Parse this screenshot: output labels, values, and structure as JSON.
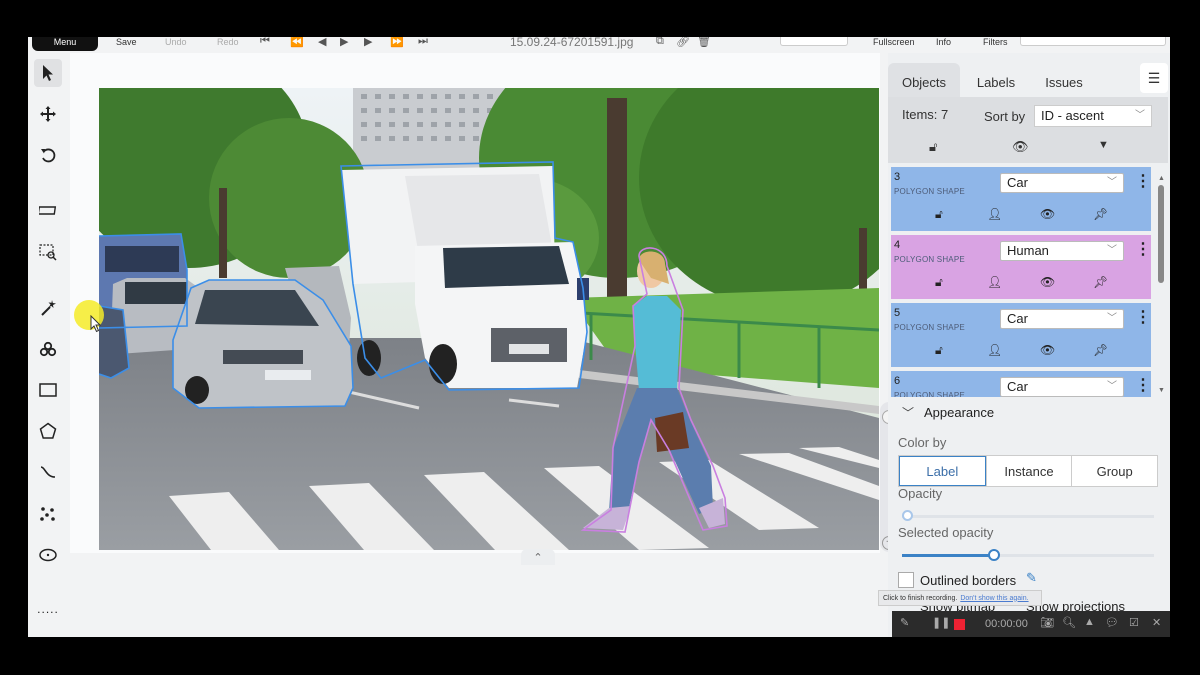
{
  "toolbar": {
    "menu": "Menu",
    "save": "Save",
    "undo": "Undo",
    "redo": "Redo",
    "filename": "15.09.24-67201591.jpg",
    "fullscreen": "Fullscreen",
    "info": "Info",
    "filters": "Filters"
  },
  "left_tools": [
    "cursor-icon",
    "move-icon",
    "rotate-icon",
    "ruler-icon",
    "zoom-region-icon",
    "magic-wand-icon",
    "brush-icon",
    "rectangle-icon",
    "polygon-icon",
    "polyline-icon",
    "points-icon",
    "ellipse-icon",
    "more-icon"
  ],
  "panel": {
    "tabs": [
      "Objects",
      "Labels",
      "Issues"
    ],
    "items_count": "Items: 7",
    "sort_by_label": "Sort by",
    "sort_by_value": "ID - ascent",
    "objects": [
      {
        "id": "3",
        "shape": "POLYGON SHAPE",
        "label": "Car",
        "color": "#8fb6e8"
      },
      {
        "id": "4",
        "shape": "POLYGON SHAPE",
        "label": "Human",
        "color": "#d9a3e3"
      },
      {
        "id": "5",
        "shape": "POLYGON SHAPE",
        "label": "Car",
        "color": "#8fb6e8"
      },
      {
        "id": "6",
        "shape": "POLYGON SHAPE",
        "label": "Car",
        "color": "#8fb6e8"
      }
    ],
    "appearance": {
      "title": "Appearance",
      "color_by_label": "Color by",
      "color_by_options": [
        "Label",
        "Instance",
        "Group"
      ],
      "color_by_selected": "Label",
      "opacity_label": "Opacity",
      "opacity_value": 0.02,
      "selected_opacity_label": "Selected opacity",
      "selected_opacity_value": 0.35,
      "outlined_borders": "Outlined borders",
      "show_bitmap": "Show bitmap",
      "show_projections": "Show projections"
    }
  },
  "recorder": {
    "tooltip_text": "Click to finish recording.",
    "tooltip_link": "Don't show this again.",
    "time": "00:00:00"
  },
  "colors": {
    "car_outline": "#3b8ee8",
    "human_outline": "#c97fe0"
  }
}
